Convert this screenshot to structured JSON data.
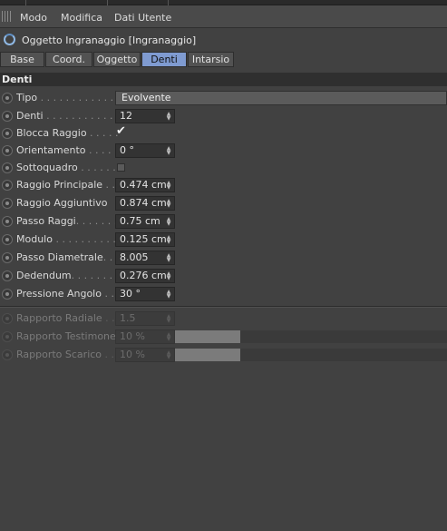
{
  "menu": {
    "items": [
      "Modo",
      "Modifica",
      "Dati Utente"
    ]
  },
  "object": {
    "title": "Oggetto Ingranaggio [Ingranaggio]"
  },
  "tabs": [
    "Base",
    "Coord.",
    "Oggetto",
    "Denti",
    "Intarsio"
  ],
  "active_tab": "Denti",
  "section": {
    "title": "Denti"
  },
  "params": {
    "tipo": {
      "label": "Tipo",
      "dots": " . . . . . . . . . . . . .",
      "value": "Evolvente"
    },
    "denti": {
      "label": "Denti",
      "dots": " . . . . . . . . . . . .",
      "value": "12"
    },
    "blocca": {
      "label": "Blocca Raggio",
      "dots": " . . . . .",
      "checked": true,
      "mark": "✔"
    },
    "orientamento": {
      "label": "Orientamento",
      "dots": " . . . . .",
      "value": "0 °"
    },
    "sottoquadro": {
      "label": "Sottoquadro",
      "dots": " . . . . . .",
      "checked": false
    },
    "raggio_principale": {
      "label": "Raggio Principale",
      "dots": " . .",
      "value": "0.474 cm"
    },
    "raggio_aggiuntivo": {
      "label": "Raggio Aggiuntivo",
      "dots": "",
      "value": "0.874 cm"
    },
    "passo_raggi": {
      "label": "Passo Raggi",
      "dots": ". . . . . . .",
      "value": "0.75 cm"
    },
    "modulo": {
      "label": "Modulo",
      "dots": " . . . . . . . . . .",
      "value": "0.125 cm"
    },
    "passo_diametrale": {
      "label": "Passo Diametrale",
      "dots": ". .",
      "value": "8.005"
    },
    "dedendum": {
      "label": "Dedendum",
      "dots": ". . . . . . . .",
      "value": "0.276 cm"
    },
    "pressione": {
      "label": "Pressione Angolo",
      "dots": " . .",
      "value": "30 °"
    }
  },
  "disabled_params": {
    "rapporto_radiale": {
      "label": "Rapporto Radiale",
      "dots": " . .",
      "value": "1.5"
    },
    "rapporto_testimone": {
      "label": "Rapporto Testimone",
      "dots": "",
      "value": "10 %",
      "level": 0.1
    },
    "rapporto_scarico": {
      "label": "Rapporto Scarico",
      "dots": " . .",
      "value": "10 %",
      "level": 0.1
    }
  },
  "icons": {
    "grip": "grip-icon",
    "object": "gear-object-icon",
    "radio": "animation-radio-icon",
    "stepper": "stepper-arrows-icon"
  },
  "colors": {
    "background": "#414141",
    "active_tab": "#7f9bd1",
    "object_icon": "#8fb8e4"
  }
}
